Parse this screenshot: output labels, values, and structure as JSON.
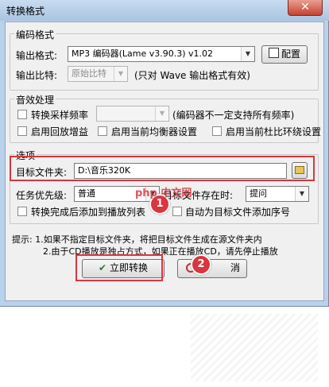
{
  "window": {
    "title": "转换格式",
    "close": "✕"
  },
  "encode_group": {
    "legend": "编码格式",
    "output_format_label": "输出格式:",
    "output_format_value": "MP3 编码器(Lame v3.90.3) v1.02",
    "config_button": "配置",
    "bitrate_label": "输出比特:",
    "bitrate_value": "原始比特",
    "bitrate_note": "(只对 Wave 输出格式有效)"
  },
  "effects_group": {
    "legend": "音效处理",
    "resample_label": "转换采样频率",
    "resample_note": "(编码器不一定支持所有频率)",
    "replay_gain_label": "启用回放增益",
    "eq_label": "启用当前均衡器设置",
    "dolby_label": "启用当前杜比环绕设置"
  },
  "options_group": {
    "legend": "选项",
    "target_folder_label": "目标文件夹:",
    "target_folder_value": "D:\\音乐320K",
    "priority_label": "任务优先级:",
    "priority_value": "普通",
    "exists_label": "目标文件存在时:",
    "exists_value": "提问",
    "add_to_playlist_label": "转换完成后添加到播放列表",
    "auto_number_label": "自动为目标文件添加序号"
  },
  "tips": {
    "line1": "提示: 1.如果不指定目标文件夹，将把目标文件生成在源文件夹内",
    "line2": "2.由于CD播放是独占方式，如果正在播放CD，请先停止播放"
  },
  "actions": {
    "convert_button": "立即转换",
    "cancel_button": "消"
  },
  "annotations": {
    "badge1": "1",
    "badge2": "2",
    "watermark": "php 中文网"
  },
  "colors": {
    "highlight": "#d9363e",
    "title_bar": "#b9d1ea"
  }
}
